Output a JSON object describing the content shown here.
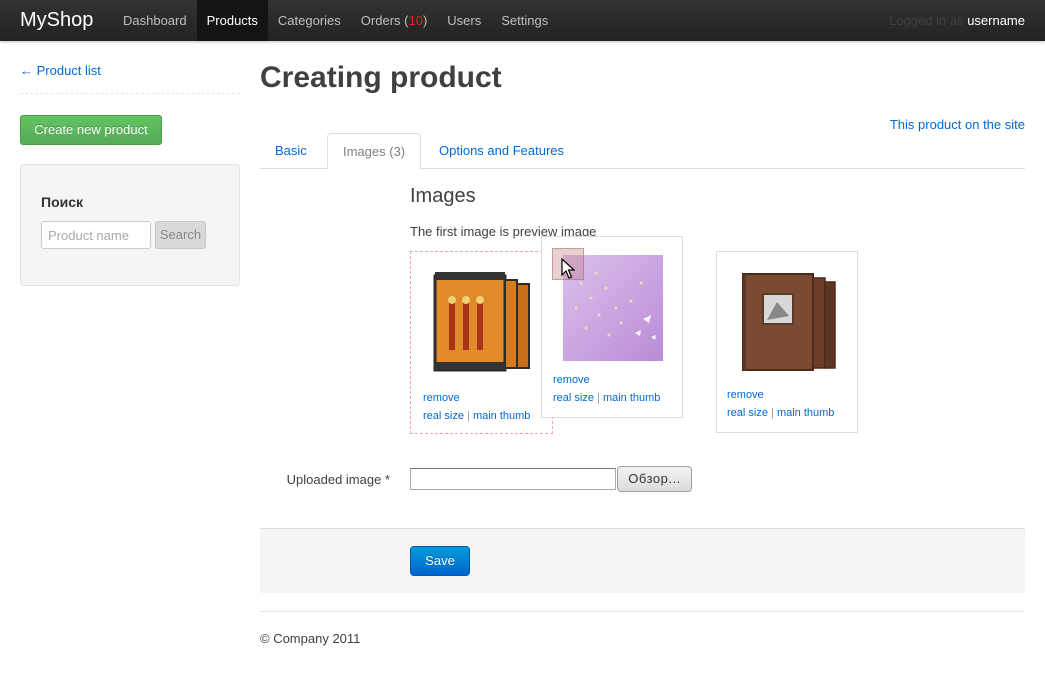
{
  "topbar": {
    "brand": "MyShop",
    "nav": [
      {
        "label": "Dashboard"
      },
      {
        "label": "Products",
        "active": true
      },
      {
        "label": "Categories"
      },
      {
        "label": "Orders (",
        "count": "10",
        "suffix": ")"
      },
      {
        "label": "Users"
      },
      {
        "label": "Settings"
      }
    ],
    "logged_in_prefix": "Logged in as",
    "username": "username"
  },
  "sidebar": {
    "back_link": "← Product list",
    "create_button": "Create new product",
    "search": {
      "title": "Поиск",
      "placeholder": "Product name",
      "button": "Search"
    }
  },
  "main": {
    "title": "Creating product",
    "site_link": "This product on the site",
    "tabs": [
      {
        "label": "Basic"
      },
      {
        "label": "Images (3)",
        "active": true
      },
      {
        "label": "Options and Features"
      }
    ],
    "images_section": {
      "title": "Images",
      "hint": "The first image is preview image",
      "thumbs": [
        {
          "remove": "remove",
          "real_size": "real size",
          "main_thumb": "main thumb",
          "depicts": "orange-photo-album"
        },
        {
          "remove": "remove",
          "real_size": "real size",
          "main_thumb": "main thumb",
          "depicts": "lilac-photo-album"
        },
        {
          "remove": "remove",
          "real_size": "real size",
          "main_thumb": "main thumb",
          "depicts": "brown-photo-album"
        }
      ]
    },
    "upload": {
      "label": "Uploaded image *",
      "browse_button": "Обзор..."
    },
    "save_button": "Save"
  },
  "footer": {
    "copyright": "© Company 2011"
  },
  "colors": {
    "link": "#0069d6",
    "success": "#57a957",
    "primary": "#0064cd",
    "topbar": "#222222"
  }
}
